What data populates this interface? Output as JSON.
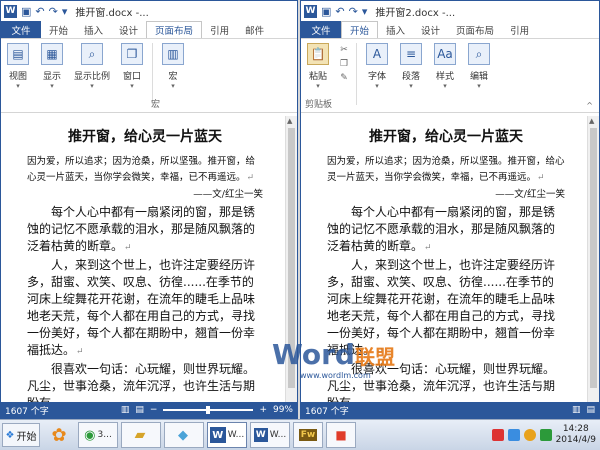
{
  "window_a": {
    "title": "推开窗.docx -...",
    "tabs": [
      "文件",
      "开始",
      "插入",
      "设计",
      "页面布局",
      "引用",
      "邮件"
    ],
    "active_tab": 4,
    "ribbon": {
      "buttons": [
        {
          "label": "视图",
          "icon": "view-icon"
        },
        {
          "label": "显示",
          "icon": "show-icon"
        },
        {
          "label": "显示比例",
          "icon": "zoom-icon"
        },
        {
          "label": "窗口",
          "icon": "window-icon"
        },
        {
          "label": "宏",
          "icon": "macro-icon"
        }
      ],
      "group_label": "宏"
    },
    "status": {
      "words": "1607 个字",
      "zoom": "99%"
    }
  },
  "window_b": {
    "title": "推开窗2.docx -...",
    "tabs": [
      "文件",
      "开始",
      "插入",
      "设计",
      "页面布局",
      "引用"
    ],
    "active_tab": 1,
    "ribbon": {
      "buttons": [
        {
          "label": "粘贴",
          "icon": "paste-icon"
        },
        {
          "label": "字体",
          "icon": "font-icon"
        },
        {
          "label": "段落",
          "icon": "paragraph-icon"
        },
        {
          "label": "样式",
          "icon": "styles-icon"
        },
        {
          "label": "编辑",
          "icon": "editing-icon"
        }
      ],
      "group_label": "剪贴板"
    },
    "status": {
      "words": "1607 个字"
    }
  },
  "document": {
    "title": "推开窗，给心灵一片蓝天",
    "intro": "因为爱，所以追求；因为沧桑，所以坚强。推开窗，给心灵一片蓝天，当你学会微笑，幸福，已不再遥远。",
    "author": "——文/红尘一笑",
    "para1": "每个人心中都有一扇紧闭的窗，那是锈蚀的记忆不愿承载的泪水，那是随风飘落的泛着枯黄的断章。",
    "para2": "人，来到这个世上，也许注定要经历许多，甜蜜、欢笑、叹息、彷徨......在季节的河床上绽舞花开花谢，在流年的睫毛上品味地老天荒，每个人都在用自己的方式，寻找一份美好，每个人都在期盼中，翘首一份幸福抵达。",
    "para3": "很喜欢一句话：心玩耀，则世界玩耀。凡尘，世事沧桑，流年沉浮，也许生活与期盼有"
  },
  "taskbar": {
    "start_label": "开始",
    "items": [
      {
        "label": "3...",
        "icon": "browser-icon"
      },
      {
        "label": "",
        "icon": "folder-icon"
      },
      {
        "label": "",
        "icon": "word-icon"
      },
      {
        "label": "W...",
        "icon": "word-icon"
      },
      {
        "label": "W...",
        "icon": "word-icon"
      },
      {
        "label": "",
        "icon": "app-icon"
      }
    ],
    "clock_time": "14:28",
    "clock_date": "2014/4/9"
  },
  "watermark": {
    "word": "Word",
    "cn": "联盟",
    "url": "www.wordlm.com"
  },
  "colors": {
    "word_blue": "#2b579a",
    "file_tab": "#2b579a"
  }
}
